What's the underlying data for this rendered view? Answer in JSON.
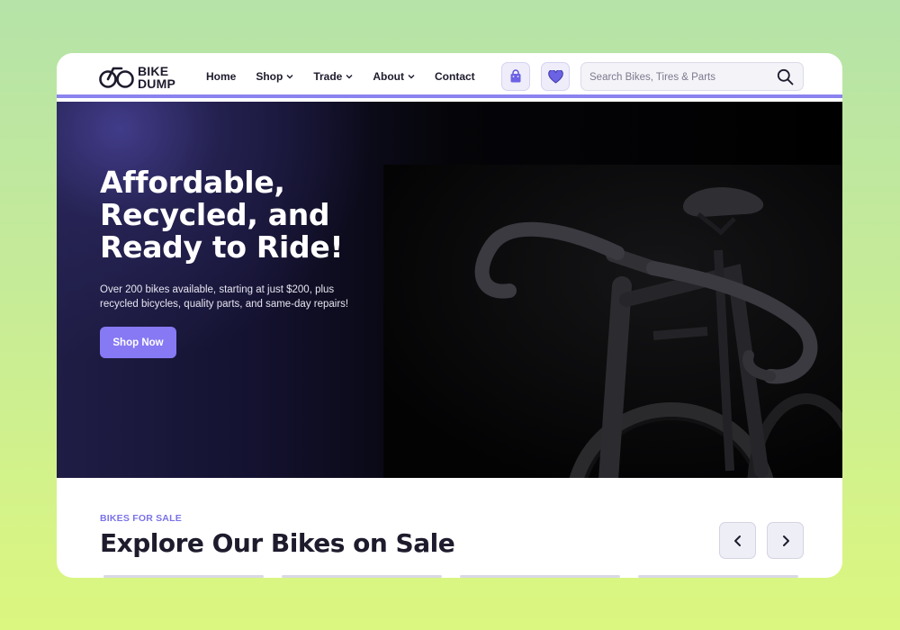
{
  "header": {
    "logo": {
      "line1": "BIKE",
      "line2": "DUMP",
      "icon": "bicycle-logo-icon"
    },
    "nav": [
      {
        "label": "Home",
        "has_dropdown": false
      },
      {
        "label": "Shop",
        "has_dropdown": true
      },
      {
        "label": "Trade",
        "has_dropdown": true
      },
      {
        "label": "About",
        "has_dropdown": true
      },
      {
        "label": "Contact",
        "has_dropdown": false
      }
    ],
    "cart_icon": "shopping-bag-icon",
    "wishlist_icon": "heart-icon",
    "search": {
      "placeholder": "Search Bikes, Tires & Parts",
      "value": "",
      "icon": "search-icon"
    }
  },
  "hero": {
    "title": "Affordable, Recycled, and Ready to Ride!",
    "subtitle": "Over 200 bikes available, starting at just $200, plus recycled bicycles, quality parts, and same-day repairs!",
    "cta_label": "Shop Now"
  },
  "bikes_section": {
    "eyebrow": "BIKES FOR SALE",
    "title": "Explore Our Bikes on Sale",
    "prev_icon": "chevron-left-icon",
    "next_icon": "chevron-right-icon"
  },
  "colors": {
    "accent": "#8679f3",
    "accent_light": "#eeedf9",
    "dark_text": "#1d1b2c",
    "hero_bg": "#050509",
    "page_bg_top": "#b5e3a8",
    "page_bg_bottom": "#dcf77f"
  }
}
